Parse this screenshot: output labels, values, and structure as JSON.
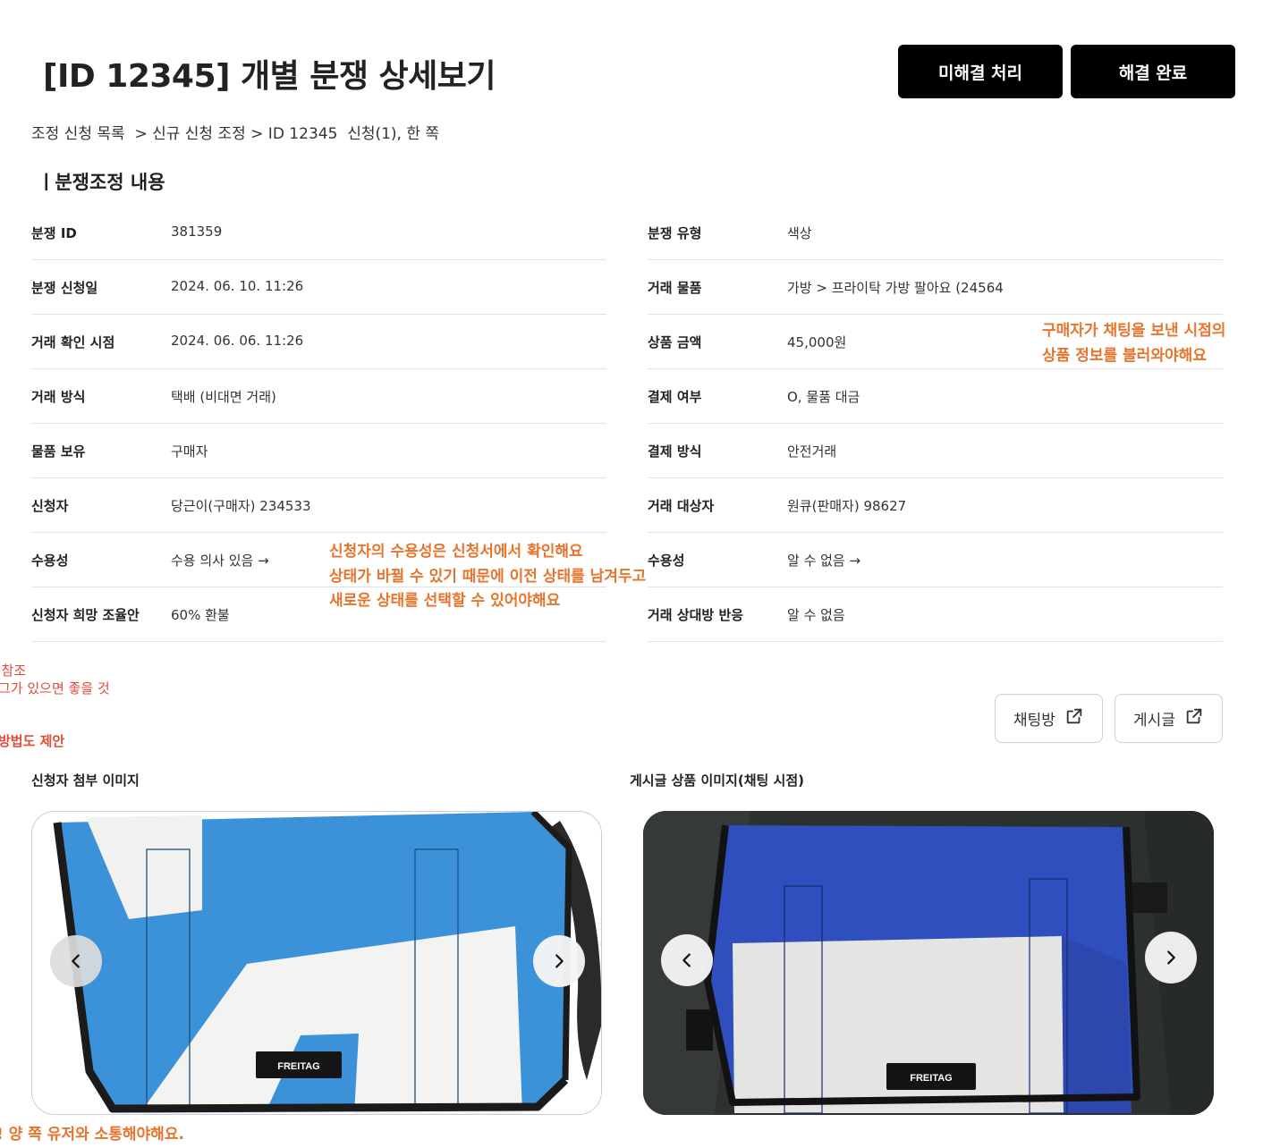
{
  "header": {
    "title": "[ID 12345] 개별 분쟁 상세보기",
    "unresolved_button": "미해결 처리",
    "resolved_button": "해결 완료"
  },
  "breadcrumb": "조정 신청 목록  > 신규 신청 조정 > ID 12345  신청(1), 한 쪽",
  "section_title": "ㅣ분쟁조정 내용",
  "left_rows": [
    {
      "label": "분쟁 ID",
      "value": "381359"
    },
    {
      "label": "분쟁 신청일",
      "value": "2024. 06. 10. 11:26"
    },
    {
      "label": "거래 확인 시점",
      "value": "2024. 06. 06. 11:26"
    },
    {
      "label": "거래 방식",
      "value": "택배 (비대면 거래)"
    },
    {
      "label": "물품 보유",
      "value": "구매자"
    },
    {
      "label": "신청자",
      "value": "당근이(구매자) 234533"
    },
    {
      "label": "수용성",
      "value": "수용 의사 있음 →"
    },
    {
      "label": "신청자 희망 조율안",
      "value": "60% 환불"
    }
  ],
  "right_rows": [
    {
      "label": "분쟁 유형",
      "value": "색상"
    },
    {
      "label": "거래 물품",
      "value": "가방 > 프라이탁 가방 팔아요 (24564"
    },
    {
      "label": "상품 금액",
      "value": "45,000원"
    },
    {
      "label": "결제 여부",
      "value": "O, 물품 대금"
    },
    {
      "label": "결제 방식",
      "value": "안전거래"
    },
    {
      "label": "거래 대상자",
      "value": "원큐(판매자) 98627"
    },
    {
      "label": "수용성",
      "value": "알 수 없음 →"
    },
    {
      "label": "거래 상대방 반응",
      "value": "알 수 없음"
    }
  ],
  "notes": {
    "price_line1": "구매자가 채팅을 보낸 시점의",
    "price_line2": "상품  정보를 불러와야해요",
    "accept_line1": "신청자의 수용성은 신청서에서 확인해요",
    "accept_line2": "상태가 바뀔 수 있기 때문에 이전 상태를 남겨두고",
    "accept_line3": "새로운 상태를 선택할 수 있어야해요"
  },
  "side_notes": {
    "line1": "· 참조",
    "line2": "그가 있으면 좋을 것",
    "line3": "방법도 제안",
    "bottom": "! 양 쪽 유저와 소통해야해요."
  },
  "links": {
    "chat_label": "채팅방",
    "post_label": "게시글"
  },
  "images": {
    "applicant_label": "신청자 첨부 이미지",
    "post_label": "게시글 상품 이미지(채팅 시점)",
    "brand_text": "FREITAG"
  },
  "colors": {
    "note_orange": "#e8742c",
    "side_note_red": "#e24b3b",
    "bag_light_blue": "#3a8fd8",
    "bag_dark_blue": "#2f4fbf"
  },
  "icons": {
    "external_link": "external-link-icon",
    "prev": "chevron-left-icon",
    "next": "chevron-right-icon"
  }
}
